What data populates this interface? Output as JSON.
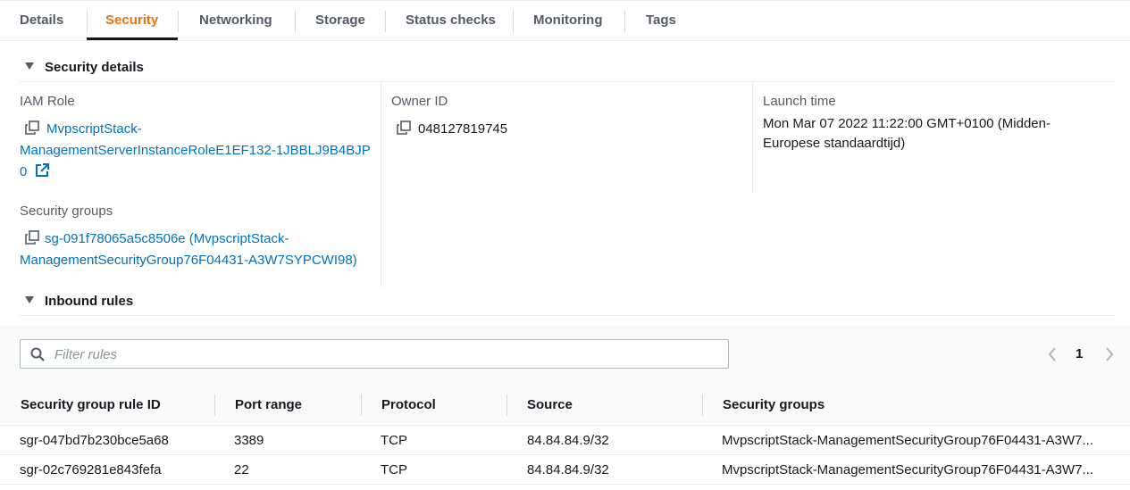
{
  "tabs": [
    {
      "label": "Details"
    },
    {
      "label": "Security"
    },
    {
      "label": "Networking"
    },
    {
      "label": "Storage"
    },
    {
      "label": "Status checks"
    },
    {
      "label": "Monitoring"
    },
    {
      "label": "Tags"
    }
  ],
  "active_tab": "Security",
  "security_details": {
    "title": "Security details",
    "iam_role_label": "IAM Role",
    "iam_role_line1": "MvpscriptStack-",
    "iam_role_line2": "ManagementServerInstanceRoleE1EF132-1JBBLJ9B4BJP",
    "iam_role_line3": "0",
    "owner_id_label": "Owner ID",
    "owner_id_value": "048127819745",
    "launch_time_label": "Launch time",
    "launch_time_line1": "Mon Mar 07 2022 11:22:00 GMT+0100 (Midden-",
    "launch_time_line2": "Europese standaardtijd)",
    "security_groups_label": "Security groups",
    "security_groups_line1": "sg-091f78065a5c8506e (MvpscriptStack-",
    "security_groups_line2": "ManagementSecurityGroup76F04431-A3W7SYPCWI98)"
  },
  "inbound_rules": {
    "title": "Inbound rules",
    "filter_placeholder": "Filter rules",
    "page": "1",
    "columns": [
      "Security group rule ID",
      "Port range",
      "Protocol",
      "Source",
      "Security groups"
    ],
    "rows": [
      {
        "rule_id": "sgr-047bd7b230bce5a68",
        "port_range": "3389",
        "protocol": "TCP",
        "source": "84.84.84.9/32",
        "security_groups": "MvpscriptStack-ManagementSecurityGroup76F04431-A3W7..."
      },
      {
        "rule_id": "sgr-02c769281e843fefa",
        "port_range": "22",
        "protocol": "TCP",
        "source": "84.84.84.9/32",
        "security_groups": "MvpscriptStack-ManagementSecurityGroup76F04431-A3W7..."
      }
    ]
  },
  "icons": {
    "copy": "copy-icon",
    "external_link": "external-link-icon",
    "search": "search-icon",
    "caret": "caret-down-icon",
    "prev": "chevron-left-icon",
    "next": "chevron-right-icon"
  },
  "colors": {
    "active_tab": "#ec7211",
    "link": "#0073bb",
    "text": "#16191f",
    "muted": "#545b64"
  }
}
